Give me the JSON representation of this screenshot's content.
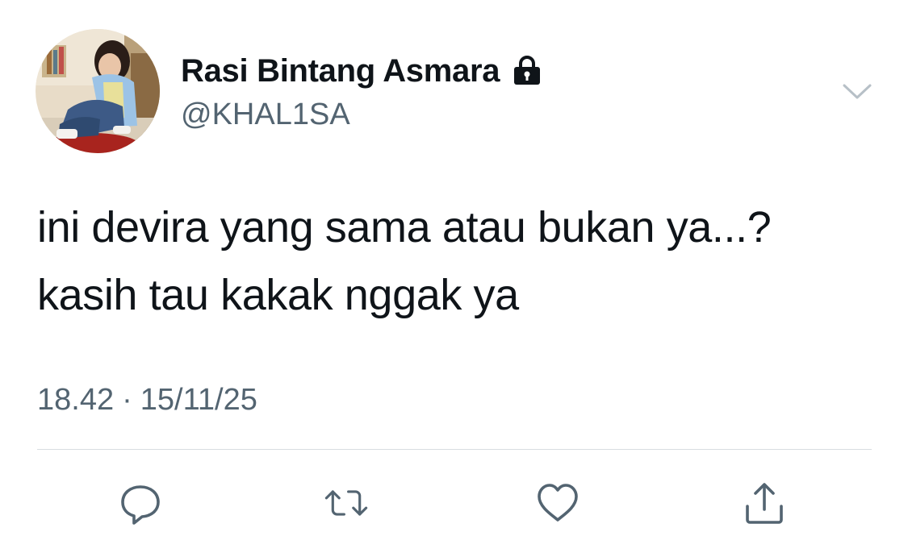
{
  "user": {
    "display_name": "Rasi Bintang Asmara",
    "handle": "@KHAL1SA",
    "protected_icon": "lock-icon"
  },
  "tweet": {
    "lines": [
      "ini devira yang sama atau bukan ya...?",
      "kasih tau kakak nggak ya"
    ],
    "time": "18.42",
    "separator": "·",
    "date": "15/11/25"
  },
  "actions": {
    "reply_icon": "reply-icon",
    "retweet_icon": "retweet-icon",
    "like_icon": "heart-icon",
    "share_icon": "share-icon",
    "menu_icon": "chevron-down-icon"
  },
  "colors": {
    "text": "#0f1419",
    "secondary": "#536471",
    "icon": "#536471",
    "divider": "#d8dde1"
  }
}
